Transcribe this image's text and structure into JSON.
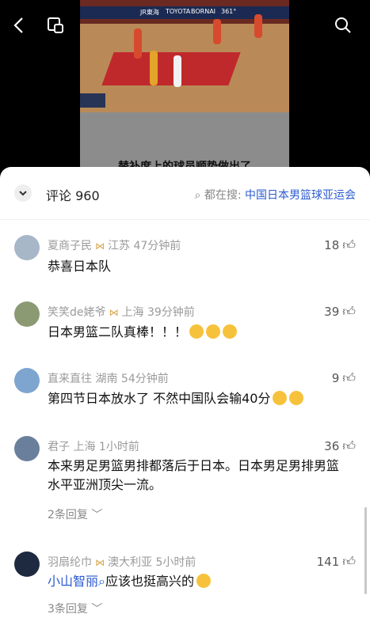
{
  "video": {
    "subtitle": "替补席上的球员顺势做出了",
    "ads": [
      "JR東海",
      "TOYOTA",
      "BORNAI",
      "361°"
    ]
  },
  "icons": {
    "back": "back-arrow-icon",
    "pip": "picture-in-picture-icon",
    "search": "search-icon"
  },
  "header": {
    "comment_count": "评论 960",
    "search_prefix": "都在搜:",
    "search_query": "中国日本男篮球亚运会"
  },
  "comments": [
    {
      "user": "夏商子民",
      "location": "江苏",
      "time": "47分钟前",
      "likes": "18",
      "text": "恭喜日本队",
      "replies": ""
    },
    {
      "user": "笑笑de姥爷",
      "location": "上海",
      "time": "39分钟前",
      "likes": "39",
      "text": "日本男篮二队真棒！！！",
      "replies": ""
    },
    {
      "user": "直来直往",
      "location": "湖南",
      "time": "54分钟前",
      "likes": "9",
      "text": "第四节日本放水了  不然中国队会输40分",
      "replies": ""
    },
    {
      "user": "君子",
      "location": "上海",
      "time": "1小时前",
      "likes": "36",
      "text": "本来男足男篮男排都落后于日本。日本男足男排男篮水平亚洲顶尖一流。",
      "replies": "2条回复"
    },
    {
      "user": "羽扇纶巾",
      "location": "澳大利亚",
      "time": "5小时前",
      "likes": "141",
      "mention": "小山智丽",
      "text": "应该也挺高兴的",
      "replies": "3条回复"
    }
  ]
}
